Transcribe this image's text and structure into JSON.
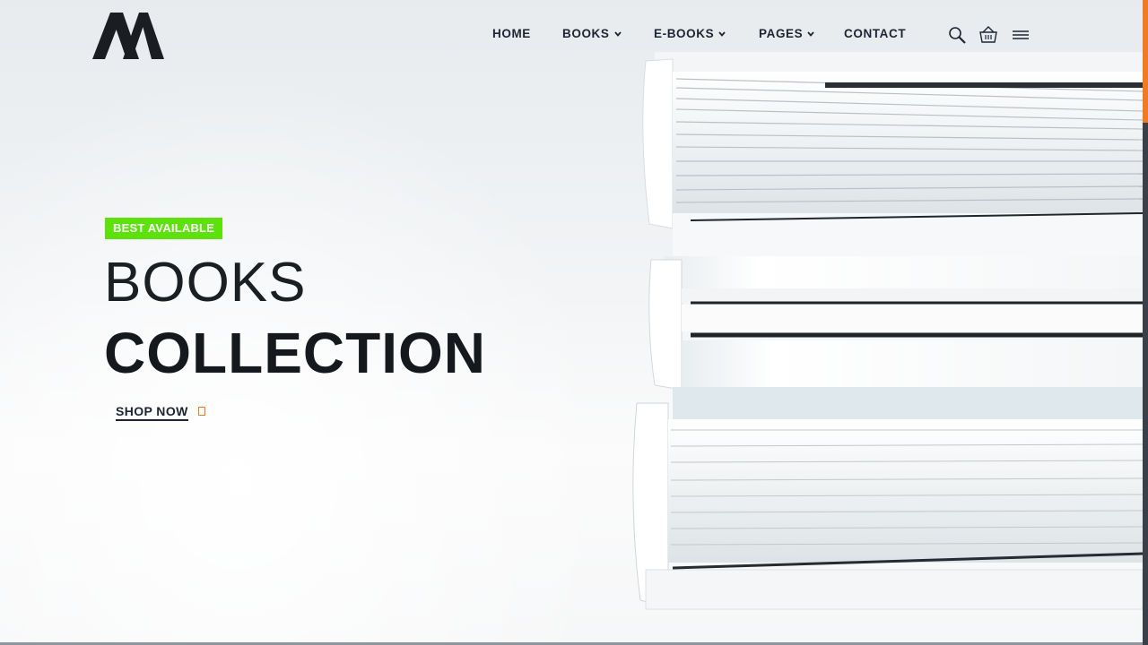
{
  "header": {
    "logo_alt": "M logo",
    "nav": [
      {
        "label": "HOME",
        "has_dropdown": false
      },
      {
        "label": "BOOKS",
        "has_dropdown": true
      },
      {
        "label": "E-BOOKS",
        "has_dropdown": true
      },
      {
        "label": "PAGES",
        "has_dropdown": true
      },
      {
        "label": "CONTACT",
        "has_dropdown": false
      }
    ],
    "icons": [
      "search-icon",
      "cart-icon",
      "menu-icon"
    ]
  },
  "hero": {
    "badge": "BEST AVAILABLE",
    "title_line1": "BOOKS",
    "title_line2": "COLLECTION",
    "cta_label": "SHOP NOW",
    "cta_icon": "arrow-icon"
  },
  "colors": {
    "badge_bg": "#5ce10b",
    "accent": "#f07b24",
    "text_dark": "#1d2433",
    "scroll_track": "#3a4047"
  }
}
